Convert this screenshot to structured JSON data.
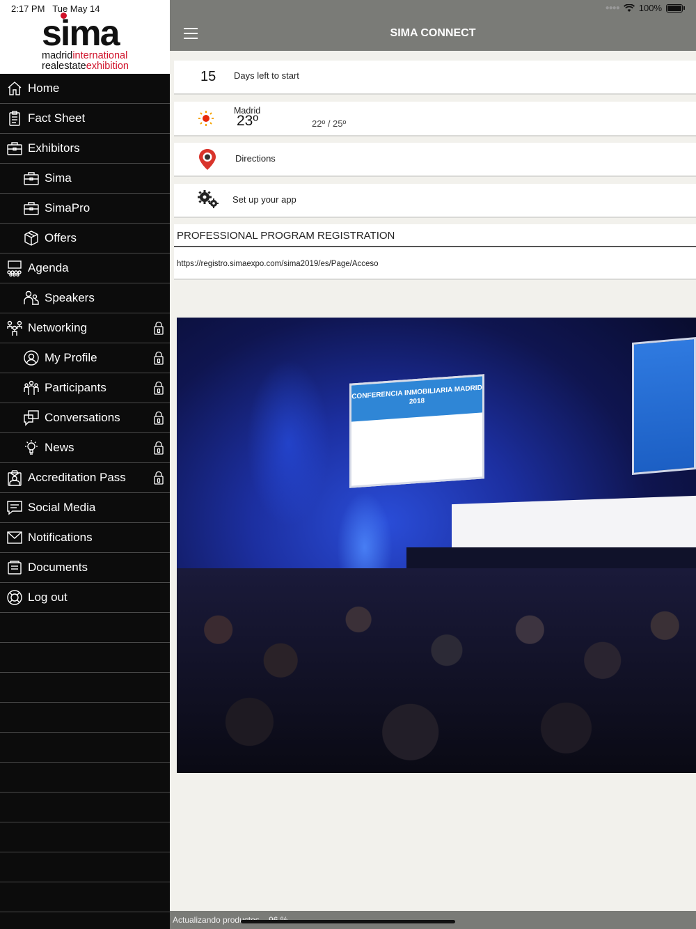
{
  "status_bar": {
    "time": "2:17 PM",
    "date": "Tue May 14",
    "battery": "100%"
  },
  "logo": {
    "word": "sima",
    "line1_a": "madrid",
    "line1_b": "international",
    "line2_a": "realestate",
    "line2_b": "exhibition"
  },
  "sidebar": {
    "items": [
      {
        "label": "Home",
        "icon": "home-icon",
        "level": "main",
        "locked": false
      },
      {
        "label": "Fact Sheet",
        "icon": "clipboard-icon",
        "level": "main",
        "locked": false
      },
      {
        "label": "Exhibitors",
        "icon": "briefcase-icon",
        "level": "main",
        "locked": false
      },
      {
        "label": "Sima",
        "icon": "briefcase-icon",
        "level": "sub",
        "locked": false
      },
      {
        "label": "SimaPro",
        "icon": "briefcase-icon",
        "level": "sub",
        "locked": false
      },
      {
        "label": "Offers",
        "icon": "box-icon",
        "level": "sub",
        "locked": false
      },
      {
        "label": "Agenda",
        "icon": "audience-icon",
        "level": "main",
        "locked": false
      },
      {
        "label": "Speakers",
        "icon": "speakers-icon",
        "level": "sub",
        "locked": false
      },
      {
        "label": "Networking",
        "icon": "network-icon",
        "level": "main",
        "locked": true
      },
      {
        "label": "My Profile",
        "icon": "profile-icon",
        "level": "sub",
        "locked": true
      },
      {
        "label": "Participants",
        "icon": "group-icon",
        "level": "sub",
        "locked": true
      },
      {
        "label": "Conversations",
        "icon": "chat-icon",
        "level": "sub",
        "locked": true
      },
      {
        "label": "News",
        "icon": "lightbulb-icon",
        "level": "sub",
        "locked": true
      },
      {
        "label": "Accreditation Pass",
        "icon": "badge-icon",
        "level": "main",
        "locked": true
      },
      {
        "label": "Social Media",
        "icon": "speech-icon",
        "level": "main",
        "locked": false
      },
      {
        "label": "Notifications",
        "icon": "envelope-icon",
        "level": "main",
        "locked": false
      },
      {
        "label": "Documents",
        "icon": "document-icon",
        "level": "main",
        "locked": false
      },
      {
        "label": "Log out",
        "icon": "logout-icon",
        "level": "main",
        "locked": false
      }
    ]
  },
  "header": {
    "title": "SIMA CONNECT"
  },
  "countdown": {
    "days": "15",
    "label": "Days left to start"
  },
  "weather": {
    "city": "Madrid",
    "temp": "23º",
    "range": "22º / 25º"
  },
  "directions": {
    "label": "Directions"
  },
  "setup": {
    "label": "Set up your app"
  },
  "registration": {
    "title": "PROFESSIONAL PROGRAM REGISTRATION",
    "url": "https://registro.simaexpo.com/sima2019/es/Page/Acceso"
  },
  "photo": {
    "screen_title": "CONFERENCIA INMOBILIARIA MADRID 2018"
  },
  "bottom": {
    "status": "Actualizando productos... 96 %"
  },
  "colors": {
    "topbar": "#7a7b77",
    "sidebar": "#0c0c0c",
    "brand_red": "#d0122a"
  }
}
